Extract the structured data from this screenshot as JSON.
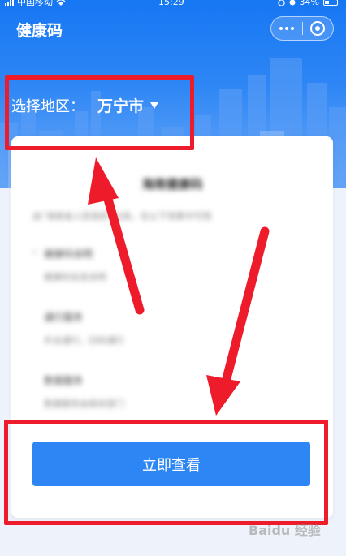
{
  "status_bar": {
    "carrier": "中国移动",
    "time": "15:29",
    "battery": "34%"
  },
  "header": {
    "title": "健康码"
  },
  "region": {
    "label": "选择地区：",
    "city": "万宁市"
  },
  "card": {
    "title": "海南健康码",
    "description": "由“海南省人民政府”出具，在以下场景中可用",
    "rules": [
      {
        "title": "健康码说明",
        "desc": "健康码信息说明"
      },
      {
        "title": "通行服务",
        "desc": "外出通行，扫码通行"
      },
      {
        "title": "数据服务",
        "desc": "数据服务由相关部门"
      }
    ],
    "cta_label": "立即查看"
  },
  "watermark": "Baidu 经验",
  "colors": {
    "primary": "#2e86f5",
    "annotation": "#ee1b2b"
  }
}
